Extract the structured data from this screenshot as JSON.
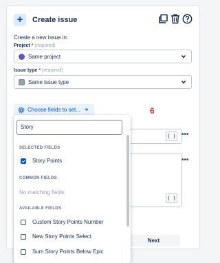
{
  "header": {
    "title": "Create issue",
    "plus_icon": "plus-icon",
    "icons": [
      "duplicate-icon",
      "trash-icon",
      "help-icon"
    ]
  },
  "intro": "Create a new issue in:",
  "project": {
    "label": "Project",
    "required_mark": "*",
    "hint": "(required)",
    "value": "Same project"
  },
  "issue_type": {
    "label": "Issue type",
    "required_mark": "*",
    "hint": "(required)",
    "value": "Same issue type"
  },
  "choose_fields": {
    "label": "Choose fields to set..."
  },
  "annotation": "6",
  "field_buttons": {
    "curly_label": "{ }",
    "more_label": "•••"
  },
  "next_button": "Next",
  "dropdown": {
    "search_value": "Story",
    "sections": {
      "selected": "SELECTED FIELDS",
      "common": "COMMON FIELDS",
      "available": "AVAILABLE FIELDS"
    },
    "selected_items": [
      {
        "label": "Story Points",
        "checked": true
      }
    ],
    "common_empty": "No matching fields",
    "available_items": [
      {
        "label": "Custom Story Points Number",
        "checked": false
      },
      {
        "label": "New Story Points Select",
        "checked": false
      },
      {
        "label": "Sum Story Points Below Epic",
        "checked": false
      }
    ]
  },
  "colors": {
    "accent": "#0052cc",
    "annotation": "#e5322d"
  }
}
